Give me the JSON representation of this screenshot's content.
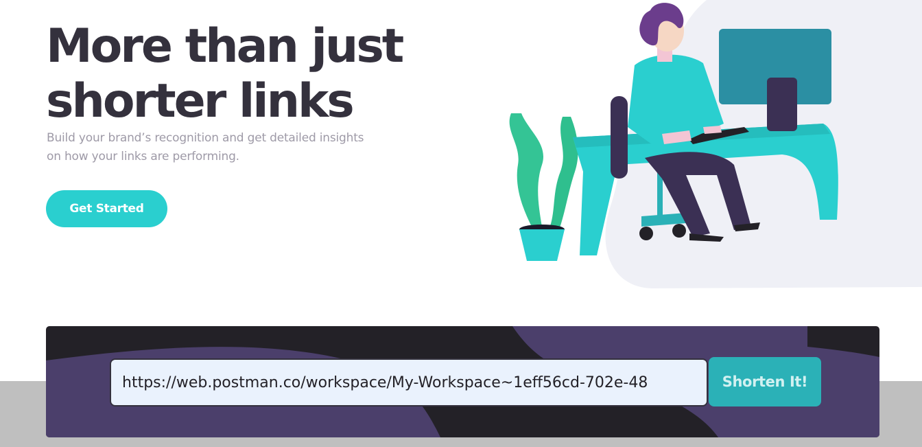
{
  "hero": {
    "title_line1": "More than just",
    "title_line2": "shorter links",
    "subtitle": "Build your brand’s recognition and get detailed insights on how your links are performing.",
    "cta_label": "Get Started"
  },
  "shortener": {
    "input_value": "https://web.postman.co/workspace/My-Workspace~1eff56cd-702e-48",
    "button_label": "Shorten It!"
  },
  "colors": {
    "primary": "#2acfcf",
    "dark_violet": "#3b3054",
    "very_dark": "#232127",
    "heading": "#34313d",
    "muted": "#9e9aa7"
  }
}
